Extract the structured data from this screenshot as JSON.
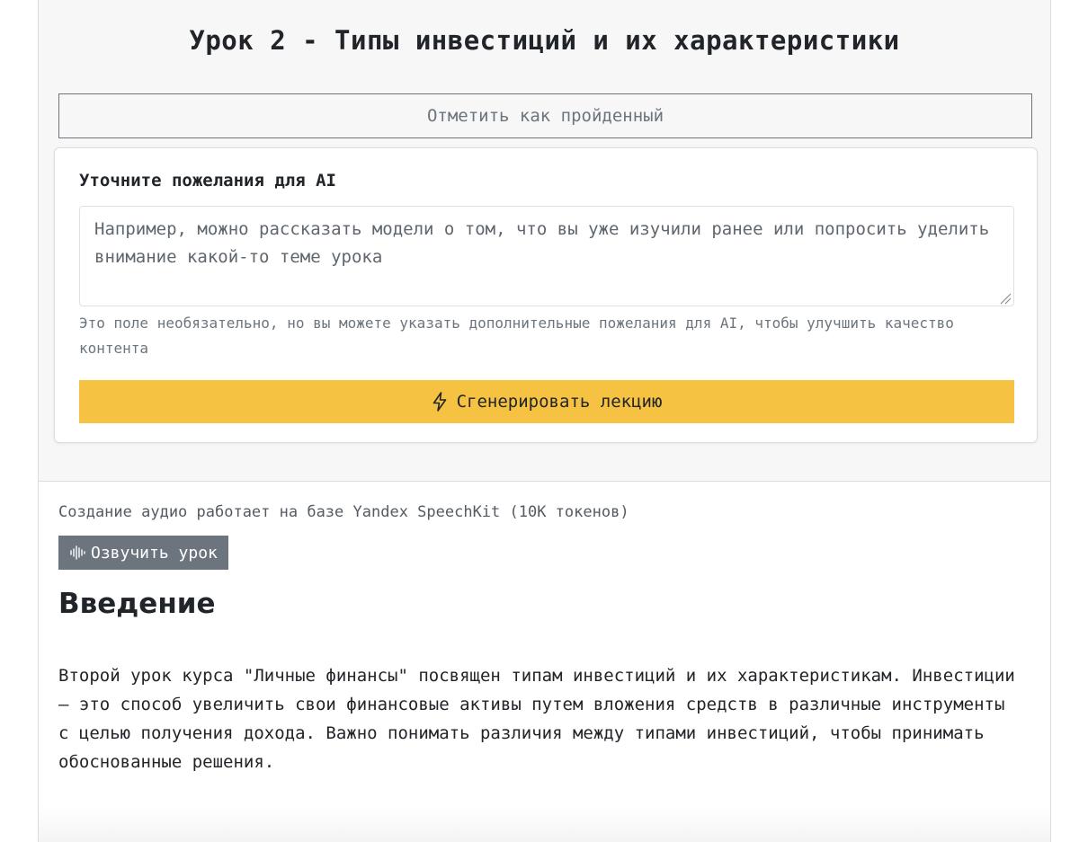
{
  "lesson": {
    "title": "Урок 2 - Типы инвестиций и их характеристики",
    "mark_done_label": "Отметить как пройденный"
  },
  "ai_card": {
    "title": "Уточните пожелания для AI",
    "textarea_placeholder": "Например, можно рассказать модели о том, что вы уже изучили ранее или попросить уделить внимание какой-то теме урока",
    "textarea_value": "",
    "hint": "Это поле необязательно, но вы можете указать дополнительные пожелания для AI, чтобы улучшить качество контента",
    "generate_label": "Сгенерировать лекцию",
    "generate_icon": "lightning-icon",
    "accent_color": "#f5c242"
  },
  "audio": {
    "note": "Создание аудио работает на базе Yandex SpeechKit (10К токенов)",
    "speak_label": "Озвучить урок",
    "speak_icon": "soundwave-icon"
  },
  "content": {
    "heading": "Введение",
    "paragraph": "Второй урок курса \"Личные финансы\" посвящен типам инвестиций и их характеристикам. Инвестиции — это способ увеличить свои финансовые активы путем вложения средств в различные инструменты с целью получения дохода. Важно понимать различия между типами инвестиций, чтобы принимать обоснованные решения."
  }
}
